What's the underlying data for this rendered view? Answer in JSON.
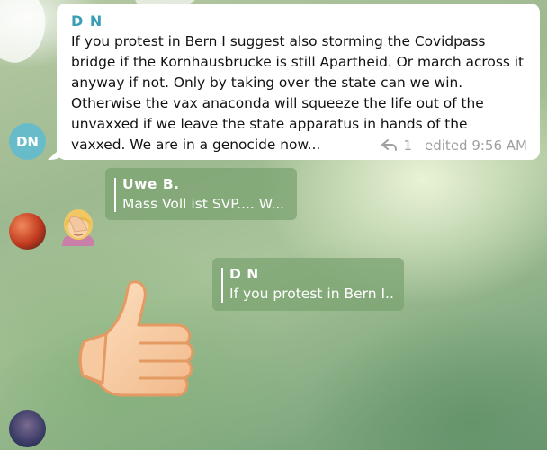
{
  "messages": {
    "main": {
      "sender": "D N",
      "avatar_initials": "DN",
      "avatar_color": "#68bcc9",
      "text": "If you protest in Bern I suggest also storming the Covidpass bridge if the Kornhausbrucke is still Apartheid.  Or march across it anyway if not. Only by taking over the state can we win. Otherwise the vax anaconda will squeeze the life out of the unvaxxed if we leave the state apparatus in hands of the vaxxed. We are in a genocide now...",
      "reply_count": "1",
      "edited_time": "edited 9:56 AM"
    },
    "reply1": {
      "quoted_sender": "Uwe B.",
      "quoted_snippet": "Mass Voll ist SVP.... W...",
      "sticker": "facepalm-emoji"
    },
    "reply2": {
      "quoted_sender": "D N",
      "quoted_snippet": "If you protest in Bern I...",
      "sticker": "thumbs-up-emoji"
    }
  },
  "colors": {
    "sender_name": "#3a9fb5",
    "reply_card_bg": "rgba(122,162,112,0.72)"
  },
  "icons": {
    "reply": "reply-arrow-icon"
  }
}
